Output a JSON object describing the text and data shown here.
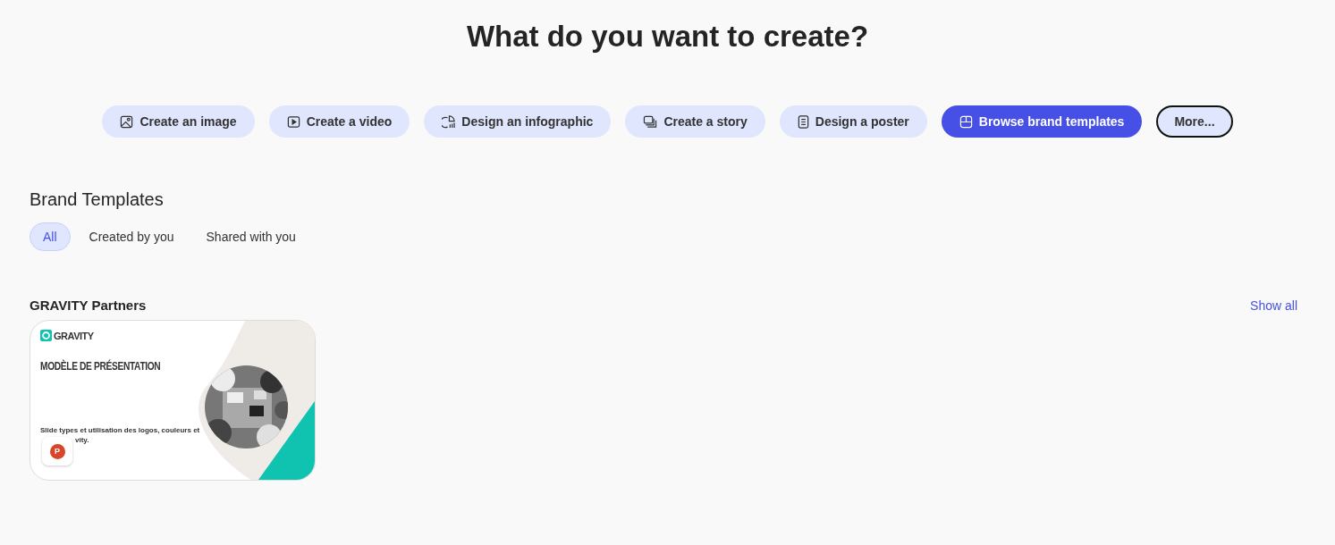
{
  "heading": "What do you want to create?",
  "actions": [
    {
      "label": "Create an image",
      "selected": false,
      "focused": false
    },
    {
      "label": "Create a video",
      "selected": false,
      "focused": false
    },
    {
      "label": "Design an infographic",
      "selected": false,
      "focused": false
    },
    {
      "label": "Create a story",
      "selected": false,
      "focused": false
    },
    {
      "label": "Design a poster",
      "selected": false,
      "focused": false
    },
    {
      "label": "Browse brand templates",
      "selected": true,
      "focused": false
    },
    {
      "label": "More...",
      "selected": false,
      "focused": true
    }
  ],
  "section": {
    "title": "Brand Templates",
    "filters": [
      {
        "label": "All",
        "selected": true
      },
      {
        "label": "Created by you",
        "selected": false
      },
      {
        "label": "Shared with you",
        "selected": false
      }
    ]
  },
  "group": {
    "title": "GRAVITY Partners",
    "link": "Show all",
    "templates": [
      {
        "logo": "GRAVITY",
        "title": "MODÈLE DE PRÉSENTATION",
        "subtitle_line_1": "Slide types et utilisation des logos, couleurs et",
        "subtitle_line_2": "vity.",
        "file_badge": "P"
      }
    ]
  }
}
